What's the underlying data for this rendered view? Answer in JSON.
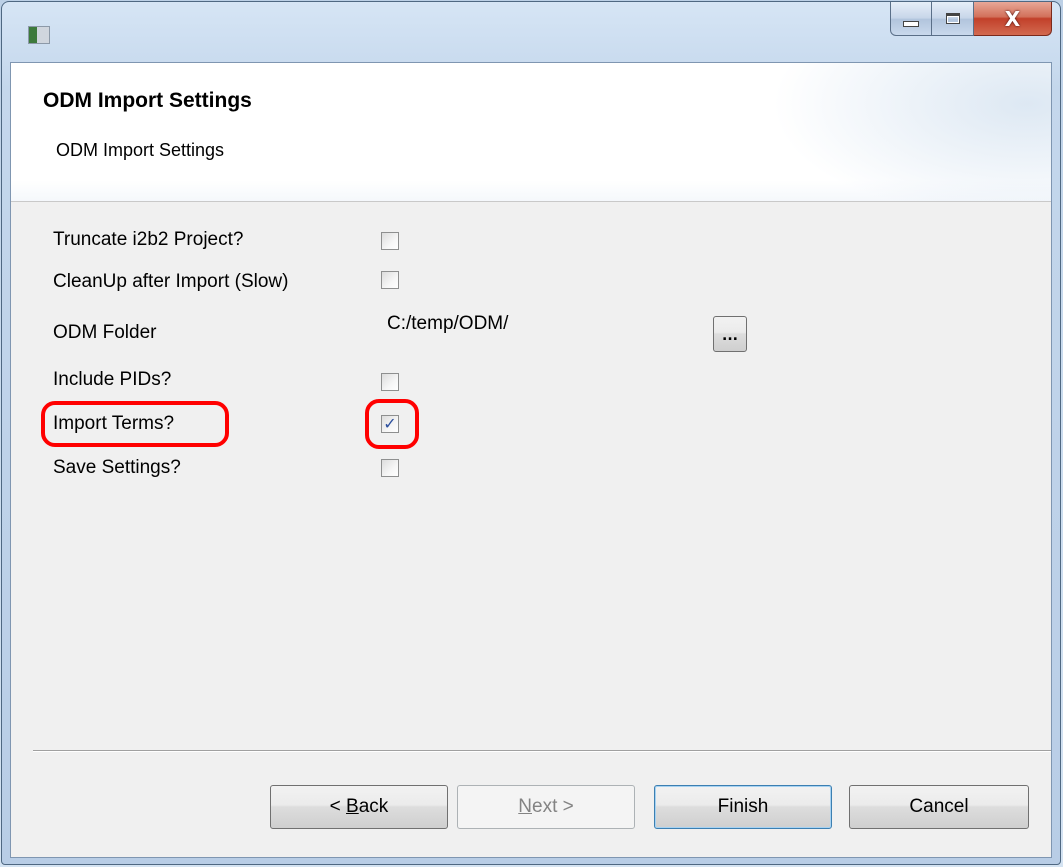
{
  "window": {
    "close_glyph": "X",
    "accent_color": "#c2402a"
  },
  "header": {
    "title": "ODM Import Settings",
    "description": "ODM Import Settings"
  },
  "form": {
    "truncate": {
      "label": "Truncate i2b2 Project?",
      "checked": false
    },
    "cleanup": {
      "label": "CleanUp after Import (Slow)",
      "checked": false
    },
    "odm_folder": {
      "label": "ODM Folder",
      "value": "C:/temp/ODM/",
      "browse_label": "..."
    },
    "include_pids": {
      "label": "Include PIDs?",
      "checked": false
    },
    "import_terms": {
      "label": "Import Terms?",
      "checked": true,
      "check_glyph": "✓"
    },
    "save_settings": {
      "label": "Save Settings?",
      "checked": false
    }
  },
  "highlight_color": "#ff0000",
  "buttons": {
    "back": {
      "prefix": "< ",
      "mnemonic": "B",
      "rest": "ack"
    },
    "next": {
      "mnemonic": "N",
      "rest": "ext >",
      "enabled": false
    },
    "finish": "Finish",
    "cancel": "Cancel"
  }
}
